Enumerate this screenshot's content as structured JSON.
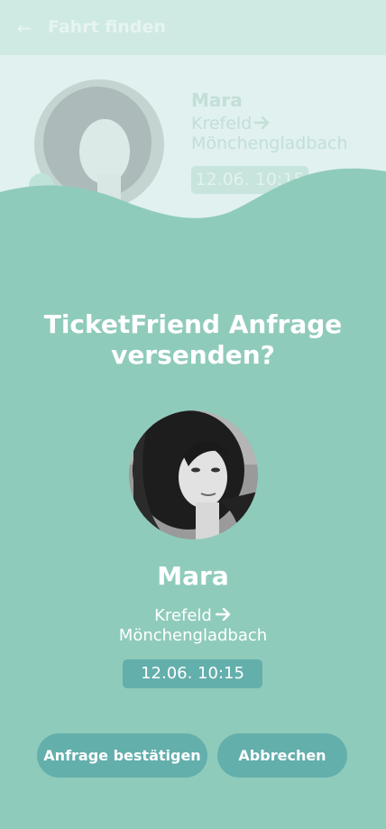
{
  "background_screen": {
    "header": {
      "title": "Fahrt finden",
      "back_icon": "arrow-left-icon"
    },
    "card": {
      "name": "Mara",
      "route_from": "Krefeld",
      "route_to": "Mönchengladbach",
      "time": "12.06. 10:15"
    }
  },
  "modal": {
    "title_line1": "TicketFriend Anfrage",
    "title_line2": "versenden?",
    "name": "Mara",
    "route_from": "Krefeld",
    "route_to": "Mönchengladbach",
    "route_icon": "arrow-right-icon",
    "time": "12.06. 10:15",
    "buttons": {
      "confirm_label": "Anfrage bestätigen",
      "cancel_label": "Abbrechen"
    }
  },
  "colors": {
    "sheet": "#8fcbbb",
    "accent_button": "#63afac",
    "background": "#e0f1ef",
    "text_on_accent": "#ffffff"
  }
}
